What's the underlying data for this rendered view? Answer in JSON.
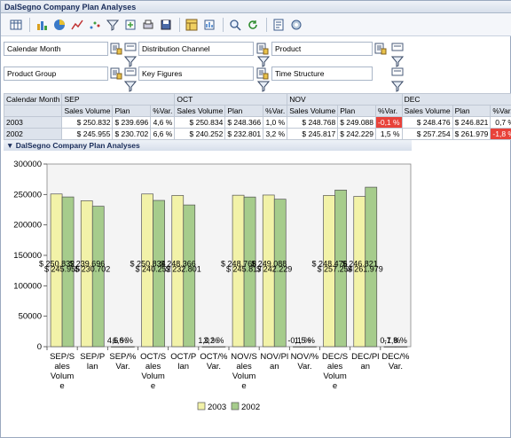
{
  "window": {
    "title": "DalSegno Company Plan Analyses"
  },
  "toolbar": {
    "icons": [
      "table-icon",
      "bar-chart-icon",
      "pie-chart-icon",
      "line-chart-icon",
      "scatter-icon",
      "filter-icon",
      "export-icon",
      "print-icon",
      "save-icon",
      "layout-icon",
      "chart-settings-icon",
      "search-icon",
      "refresh-icon",
      "info-icon",
      "settings-icon"
    ]
  },
  "filters": {
    "calendar_month": "Calendar Month",
    "distribution_channel": "Distribution Channel",
    "product": "Product",
    "product_group": "Product Group",
    "key_figures": "Key Figures",
    "time_structure": "Time Structure"
  },
  "table": {
    "corner": "Calendar Month",
    "months": [
      "SEP",
      "OCT",
      "NOV",
      "DEC"
    ],
    "subheaders": [
      "Sales Volume",
      "Plan",
      "%Var."
    ],
    "rows": [
      {
        "label": "2003",
        "cells": [
          "$ 250.832",
          "$ 239.696",
          "4,6 %",
          "$ 250.834",
          "$ 248.366",
          "1,0 %",
          "$ 248.768",
          "$ 249.088",
          "-0,1 %",
          "$ 248.476",
          "$ 246.821",
          "0,7 %"
        ]
      },
      {
        "label": "2002",
        "cells": [
          "$ 245.955",
          "$ 230.702",
          "6,6 %",
          "$ 240.252",
          "$ 232.801",
          "3,2 %",
          "$ 245.817",
          "$ 242.229",
          "1,5 %",
          "$ 257.254",
          "$ 261.979",
          "-1,8 %"
        ]
      }
    ]
  },
  "section": {
    "title": "DalSegno Company Plan Analyses"
  },
  "colors": {
    "s2003": "#f2f2a8",
    "s2002": "#a6cc8c",
    "neg": "#e8423a"
  },
  "chart_data": {
    "type": "bar",
    "categories": [
      "SEP/Sales Volume",
      "SEP/Plan",
      "SEP/% Var.",
      "OCT/Sales Volume",
      "OCT/Plan",
      "OCT/% Var.",
      "NOV/Sales Volume",
      "NOV/Plan",
      "NOV/% Var.",
      "DEC/Sales Volume",
      "DEC/Plan",
      "DEC/% Var."
    ],
    "category_labels": [
      [
        "SEP/S",
        "ales",
        "Volum",
        "e"
      ],
      [
        "SEP/P",
        "lan"
      ],
      [
        "SEP/%",
        "Var."
      ],
      [
        "OCT/S",
        "ales",
        "Volum",
        "e"
      ],
      [
        "OCT/P",
        "lan"
      ],
      [
        "OCT/%",
        "Var."
      ],
      [
        "NOV/S",
        "ales",
        "Volum",
        "e"
      ],
      [
        "NOV/Pl",
        "an"
      ],
      [
        "NOV/%",
        "Var."
      ],
      [
        "DEC/S",
        "ales",
        "Volum",
        "e"
      ],
      [
        "DEC/Pl",
        "an"
      ],
      [
        "DEC/%",
        "Var."
      ]
    ],
    "series": [
      {
        "name": "2003",
        "values": [
          250832,
          239696,
          4.6,
          250834,
          248366,
          1.0,
          248768,
          249088,
          -0.1,
          248476,
          246821,
          0.7
        ],
        "labels": [
          "$ 250.832",
          "$ 239.696",
          "4,6 %",
          "$ 250.834",
          "$ 248.366",
          "1,0 %",
          "$ 248.768",
          "$ 249.088",
          "-0,1 %",
          "$ 248.476",
          "$ 246.821",
          "0,7 %"
        ]
      },
      {
        "name": "2002",
        "values": [
          245955,
          230702,
          6.6,
          240252,
          232801,
          3.2,
          245817,
          242229,
          1.5,
          257254,
          261979,
          -1.8
        ],
        "labels": [
          "$ 245.955",
          "$ 230.702",
          "6,6 %",
          "$ 240.252",
          "$ 232.801",
          "3,2 %",
          "$ 245.817",
          "$ 242.229",
          "1,5 %",
          "$ 257.254",
          "$ 261.979",
          "-1,8 %"
        ]
      }
    ],
    "yticks": [
      "0",
      "50000",
      "100000",
      "150000",
      "200000",
      "250000",
      "300000"
    ],
    "ylim": [
      0,
      300000
    ],
    "grid": false,
    "legend": "bottom"
  }
}
